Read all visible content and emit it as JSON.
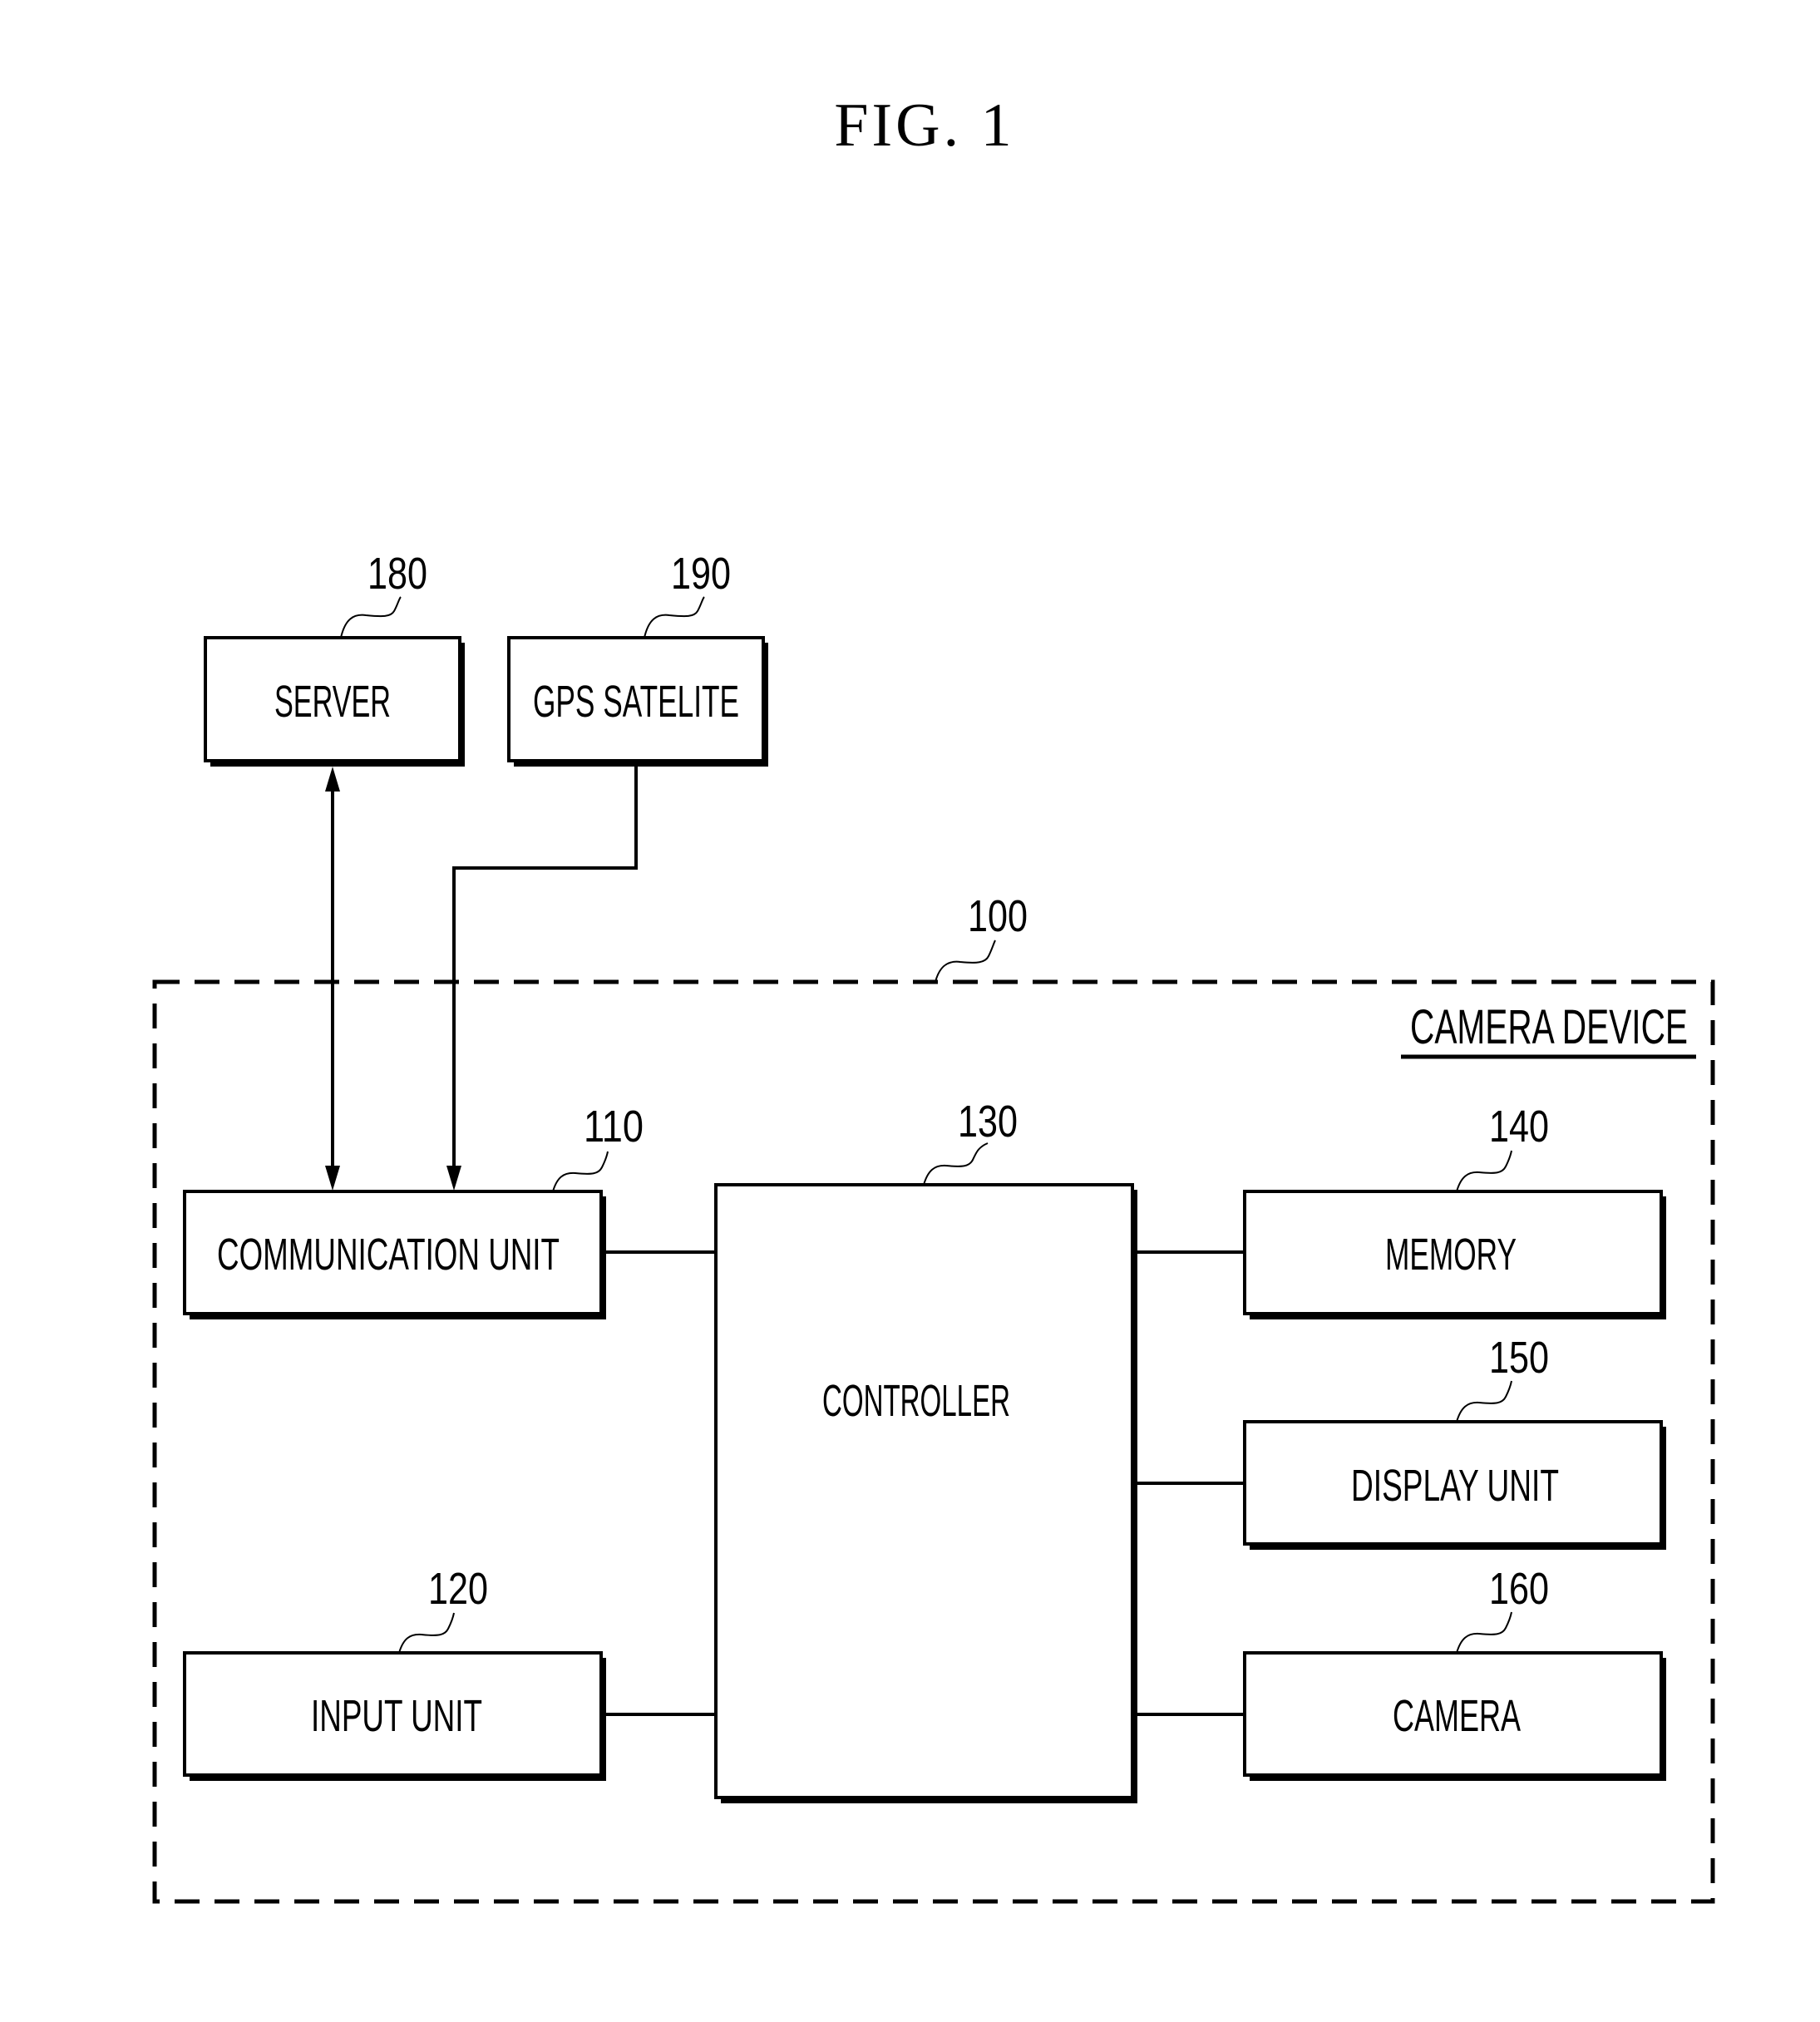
{
  "figure": {
    "title": "FIG. 1"
  },
  "container": {
    "ref": "100",
    "label": "CAMERA DEVICE"
  },
  "external": {
    "server": {
      "label": "SERVER",
      "ref": "180"
    },
    "gps": {
      "label": "GPS SATELITE",
      "ref": "190"
    }
  },
  "blocks": {
    "communication": {
      "label": "COMMUNICATION UNIT",
      "ref": "110"
    },
    "input": {
      "label": "INPUT UNIT",
      "ref": "120"
    },
    "controller": {
      "label": "CONTROLLER",
      "ref": "130"
    },
    "memory": {
      "label": "MEMORY",
      "ref": "140"
    },
    "display": {
      "label": "DISPLAY UNIT",
      "ref": "150"
    },
    "camera": {
      "label": "CAMERA",
      "ref": "160"
    }
  },
  "connections": [
    {
      "from": "SERVER",
      "to": "COMMUNICATION UNIT",
      "type": "bidirectional-arrow"
    },
    {
      "from": "GPS SATELITE",
      "to": "COMMUNICATION UNIT",
      "type": "arrow"
    },
    {
      "from": "COMMUNICATION UNIT",
      "to": "CONTROLLER",
      "type": "line"
    },
    {
      "from": "INPUT UNIT",
      "to": "CONTROLLER",
      "type": "line"
    },
    {
      "from": "CONTROLLER",
      "to": "MEMORY",
      "type": "line"
    },
    {
      "from": "CONTROLLER",
      "to": "DISPLAY UNIT",
      "type": "line"
    },
    {
      "from": "CONTROLLER",
      "to": "CAMERA",
      "type": "line"
    }
  ]
}
